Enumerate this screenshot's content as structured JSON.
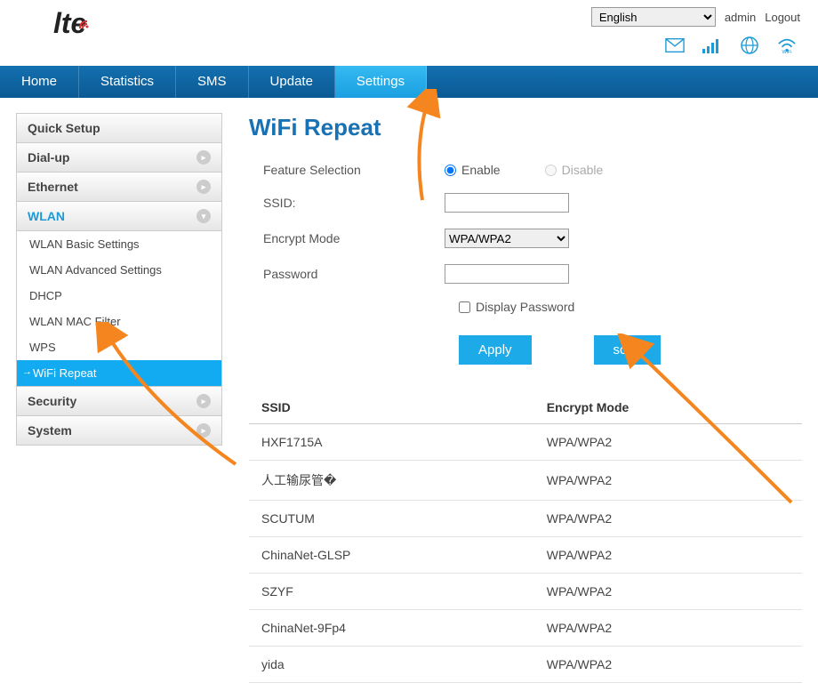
{
  "header": {
    "logo": "lte",
    "lang": "English",
    "user": "admin",
    "logout": "Logout"
  },
  "nav": [
    "Home",
    "Statistics",
    "SMS",
    "Update",
    "Settings"
  ],
  "nav_active": "Settings",
  "sidebar": {
    "quick": "Quick Setup",
    "dialup": "Dial-up",
    "ethernet": "Ethernet",
    "wlan": "WLAN",
    "wlan_subs": [
      "WLAN Basic Settings",
      "WLAN Advanced Settings",
      "DHCP",
      "WLAN MAC Filter",
      "WPS",
      "WiFi Repeat"
    ],
    "wlan_active": "WiFi Repeat",
    "security": "Security",
    "system": "System"
  },
  "page": {
    "title": "WiFi Repeat",
    "feature_label": "Feature Selection",
    "enable": "Enable",
    "disable": "Disable",
    "ssid_label": "SSID:",
    "encrypt_label": "Encrypt Mode",
    "encrypt_value": "WPA/WPA2",
    "password_label": "Password",
    "display_pw": "Display Password",
    "apply": "Apply",
    "scan": "scan",
    "th_ssid": "SSID",
    "th_mode": "Encrypt Mode"
  },
  "networks": [
    {
      "ssid": "HXF1715A",
      "mode": "WPA/WPA2"
    },
    {
      "ssid": "人工输尿管�",
      "mode": "WPA/WPA2"
    },
    {
      "ssid": "SCUTUM",
      "mode": "WPA/WPA2"
    },
    {
      "ssid": "ChinaNet-GLSP",
      "mode": "WPA/WPA2"
    },
    {
      "ssid": "SZYF",
      "mode": "WPA/WPA2"
    },
    {
      "ssid": "ChinaNet-9Fp4",
      "mode": "WPA/WPA2"
    },
    {
      "ssid": "yida",
      "mode": "WPA/WPA2"
    }
  ]
}
